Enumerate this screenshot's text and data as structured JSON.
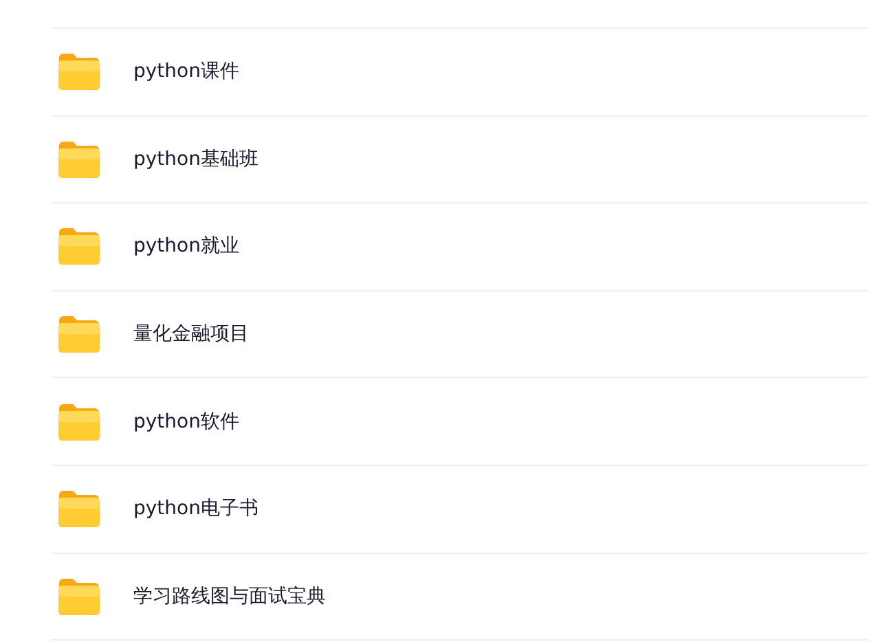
{
  "folders": [
    {
      "name": "python课件"
    },
    {
      "name": "python基础班"
    },
    {
      "name": "python就业"
    },
    {
      "name": "量化金融项目"
    },
    {
      "name": "python软件"
    },
    {
      "name": "python电子书"
    },
    {
      "name": "学习路线图与面试宝典"
    }
  ]
}
